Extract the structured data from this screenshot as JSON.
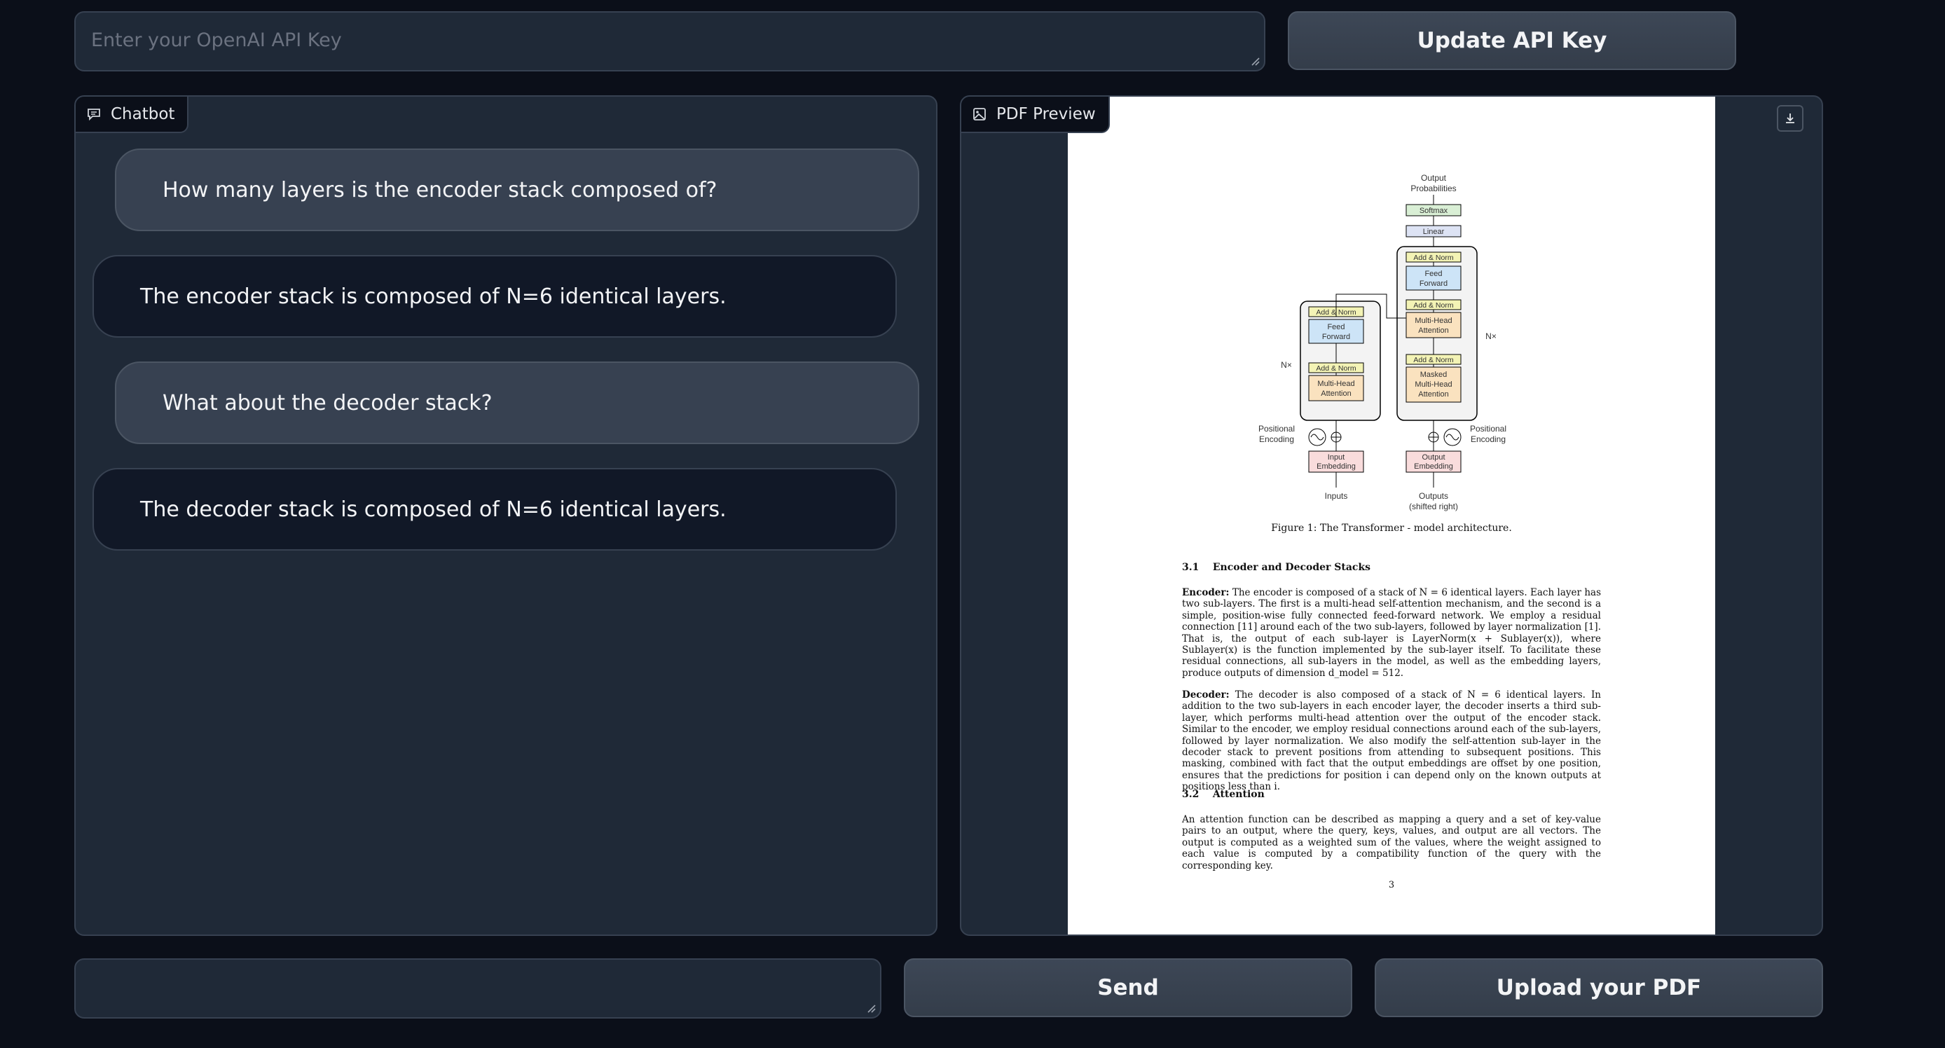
{
  "api_key": {
    "placeholder": "Enter your OpenAI API Key",
    "value": "",
    "update_button": "Update API Key"
  },
  "chatbot": {
    "label": "Chatbot",
    "messages": [
      {
        "role": "user",
        "text": "How many layers is the encoder stack composed of?"
      },
      {
        "role": "assistant",
        "text": "The encoder stack is composed of N=6 identical layers."
      },
      {
        "role": "user",
        "text": "What about the decoder stack?"
      },
      {
        "role": "assistant",
        "text": "The decoder stack is composed of N=6 identical layers."
      }
    ]
  },
  "pdf_preview": {
    "label": "PDF Preview",
    "page": {
      "figure": {
        "output_probabilities": "Output\nProbabilities",
        "softmax": "Softmax",
        "linear": "Linear",
        "add_norm": "Add & Norm",
        "feed_forward": "Feed\nForward",
        "multi_head_attention": "Multi-Head\nAttention",
        "masked_multi_head_attention": "Masked\nMulti-Head\nAttention",
        "nx": "N×",
        "positional_encoding": "Positional\nEncoding",
        "input_embedding": "Input\nEmbedding",
        "output_embedding": "Output\nEmbedding",
        "inputs": "Inputs",
        "outputs": "Outputs\n(shifted right)"
      },
      "caption": "Figure 1: The Transformer - model architecture.",
      "section_31": "3.1    Encoder and Decoder Stacks",
      "encoder_title": "Encoder:",
      "encoder_text": "The encoder is composed of a stack of N = 6 identical layers. Each layer has two sub-layers. The first is a multi-head self-attention mechanism, and the second is a simple, position-wise fully connected feed-forward network. We employ a residual connection [11] around each of the two sub-layers, followed by layer normalization [1]. That is, the output of each sub-layer is LayerNorm(x + Sublayer(x)), where Sublayer(x) is the function implemented by the sub-layer itself. To facilitate these residual connections, all sub-layers in the model, as well as the embedding layers, produce outputs of dimension d_model = 512.",
      "decoder_title": "Decoder:",
      "decoder_text": "The decoder is also composed of a stack of N = 6 identical layers. In addition to the two sub-layers in each encoder layer, the decoder inserts a third sub-layer, which performs multi-head attention over the output of the encoder stack. Similar to the encoder, we employ residual connections around each of the sub-layers, followed by layer normalization. We also modify the self-attention sub-layer in the decoder stack to prevent positions from attending to subsequent positions. This masking, combined with fact that the output embeddings are offset by one position, ensures that the predictions for position i can depend only on the known outputs at positions less than i.",
      "section_32": "3.2    Attention",
      "attention_text": "An attention function can be described as mapping a query and a set of key-value pairs to an output, where the query, keys, values, and output are all vectors. The output is computed as a weighted sum of the values, where the weight assigned to each value is computed by a compatibility function of the query with the corresponding key.",
      "page_number": "3"
    }
  },
  "input": {
    "value": "",
    "placeholder": ""
  },
  "buttons": {
    "send": "Send",
    "upload": "Upload your PDF"
  },
  "colors": {
    "background": "#0b0f19",
    "panel": "#1f2937",
    "border": "#374151",
    "user_bubble": "#374151",
    "bot_bubble": "#111827"
  },
  "icons": [
    "chat-icon",
    "image-icon",
    "download-icon",
    "resize-handle-icon"
  ]
}
